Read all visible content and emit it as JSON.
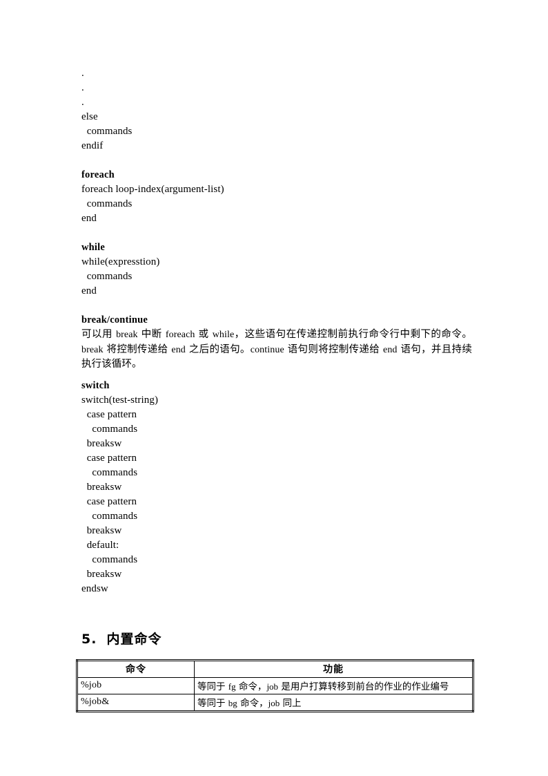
{
  "document": {
    "code_block_if_tail": {
      "lines": [
        ".",
        ".",
        ".",
        "else",
        "  commands",
        "endif"
      ]
    },
    "sections": [
      {
        "heading": "foreach",
        "lines": [
          "foreach loop-index(argument-list)",
          "  commands",
          "end"
        ]
      },
      {
        "heading": "while",
        "lines": [
          "while(expresstion)",
          "  commands",
          "end"
        ]
      }
    ],
    "break_continue": {
      "heading": "break/continue",
      "paragraph_parts": [
        {
          "type": "cn",
          "text": "可以用 "
        },
        {
          "type": "lat",
          "text": "break"
        },
        {
          "type": "cn",
          "text": " 中断 "
        },
        {
          "type": "lat",
          "text": "foreach"
        },
        {
          "type": "cn",
          "text": " 或 "
        },
        {
          "type": "lat",
          "text": "while"
        },
        {
          "type": "cn",
          "text": "，这些语句在传递控制前执行命令行中剩下的命令。"
        },
        {
          "type": "lat",
          "text": "break"
        },
        {
          "type": "cn",
          "text": " 将控制传递给 "
        },
        {
          "type": "lat",
          "text": "end"
        },
        {
          "type": "cn",
          "text": " 之后的语句。"
        },
        {
          "type": "lat",
          "text": "continue"
        },
        {
          "type": "cn",
          "text": " 语句则将控制传递给 "
        },
        {
          "type": "lat",
          "text": "end"
        },
        {
          "type": "cn",
          "text": " 语句，并且持续执行该循环。"
        }
      ],
      "paragraph_plain": "可以用 break 中断 foreach 或 while，这些语句在传递控制前执行命令行中剩下的命令。break 将控制传递给 end 之后的语句。continue 语句则将控制传递给 end 语句，并且持续执行该循环。"
    },
    "switch": {
      "heading": "switch",
      "lines": [
        "switch(test-string)",
        "  case pattern",
        "    commands",
        "  breaksw",
        "  case pattern",
        "    commands",
        "  breaksw",
        "  case pattern",
        "    commands",
        "  breaksw",
        "  default:",
        "    commands",
        "  breaksw",
        "endsw"
      ]
    },
    "builtin_section": {
      "number": "5.",
      "title": "内置命令",
      "table": {
        "columns": [
          "命令",
          "功能"
        ],
        "rows": [
          {
            "command": "%job",
            "function_plain": "等同于 fg 命令，job 是用户打算转移到前台的作业的作业编号",
            "function_parts": [
              {
                "type": "cn",
                "text": "等同于 "
              },
              {
                "type": "lat",
                "text": "fg"
              },
              {
                "type": "cn",
                "text": " 命令，"
              },
              {
                "type": "lat",
                "text": "job"
              },
              {
                "type": "cn",
                "text": " 是用户打算转移到前台的作业的作业编号"
              }
            ]
          },
          {
            "command": "%job&",
            "function_plain": "等同于 bg 命令，job 同上",
            "function_parts": [
              {
                "type": "cn",
                "text": "等同于 "
              },
              {
                "type": "lat",
                "text": "bg"
              },
              {
                "type": "cn",
                "text": " 命令，"
              },
              {
                "type": "lat",
                "text": "job"
              },
              {
                "type": "cn",
                "text": " 同上"
              }
            ]
          }
        ]
      }
    }
  },
  "colors": {
    "text": "#000000",
    "page_background": "#ffffff",
    "table_border": "#000000"
  }
}
